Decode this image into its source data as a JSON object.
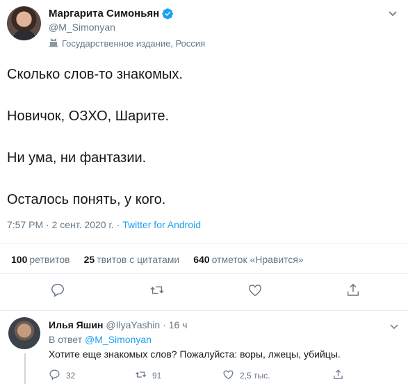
{
  "tweet": {
    "display_name": "Маргарита Симоньян",
    "handle": "@M_Simonyan",
    "label": "Государственное издание, Россия",
    "lines": [
      "Сколько слов-то знакомых.",
      "Новичок, ОЗХО, Шарите.",
      "Ни ума, ни фантазии.",
      "Осталось понять, у кого."
    ],
    "timestamp": "7:57 PM · 2 сент. 2020 г. · ",
    "source": "Twitter for Android"
  },
  "stats": {
    "retweets_count": "100",
    "retweets_label": "ретвитов",
    "quotes_count": "25",
    "quotes_label": "твитов с цитатами",
    "likes_count": "640",
    "likes_label": "отметок «Нравится»"
  },
  "reply": {
    "display_name": "Илья Яшин",
    "handle": "@IlyaYashin",
    "time": "· 16 ч",
    "reply_prefix": "В ответ",
    "reply_mention": "@M_Simonyan",
    "text": "Хотите еще знакомых слов? Пожалуйста: воры, лжецы, убийцы.",
    "reply_count": "32",
    "retweet_count": "91",
    "like_count": "2,5 тыс."
  },
  "colors": {
    "accent": "#1da1f2",
    "secondary_text": "#657786",
    "divider": "#e6ecf0"
  },
  "icons": [
    "verified-badge-icon",
    "caret-down-icon",
    "state-media-icon",
    "reply-icon",
    "retweet-icon",
    "like-icon",
    "share-icon"
  ]
}
